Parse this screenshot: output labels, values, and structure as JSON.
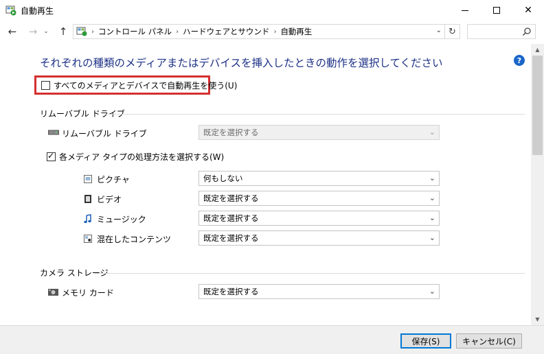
{
  "window": {
    "title": "自動再生",
    "icon": "autoplay-app-icon",
    "minimize_icon": "minimize-icon",
    "maximize_icon": "maximize-icon",
    "close_glyph": "✕"
  },
  "nav": {
    "back_glyph": "←",
    "forward_glyph": "→",
    "recent_glyph": "⌄",
    "up_glyph": "↑",
    "breadcrumb": [
      "コントロール パネル",
      "ハードウェアとサウンド",
      "自動再生"
    ],
    "breadcrumb_sep": "›",
    "dropdown_glyph": "⌄",
    "refresh_glyph": "↻",
    "search_placeholder": ""
  },
  "main": {
    "heading": "それぞれの種類のメディアまたはデバイスを挿入したときの動作を選択してください",
    "help_glyph": "?",
    "use_autoplay": {
      "label": "すべてのメディアとデバイスで自動再生を使う(U)",
      "checked": false
    },
    "removable": {
      "section_title": "リムーバブル ドライブ",
      "drive_label": "リムーバブル ドライブ",
      "drive_value": "既定を選択する",
      "per_media": {
        "label": "各メディア タイプの処理方法を選択する(W)",
        "checked": true
      },
      "media": [
        {
          "label": "ピクチャ",
          "value": "何もしない",
          "icon": "picture-icon",
          "enabled": true
        },
        {
          "label": "ビデオ",
          "value": "既定を選択する",
          "icon": "video-icon",
          "enabled": true
        },
        {
          "label": "ミュージック",
          "value": "既定を選択する",
          "icon": "music-icon",
          "enabled": true
        },
        {
          "label": "混在したコンテンツ",
          "value": "既定を選択する",
          "icon": "mixed-content-icon",
          "enabled": true
        }
      ]
    },
    "camera": {
      "section_title": "カメラ ストレージ",
      "memory_card_label": "メモリ カード",
      "memory_card_value": "既定を選択する"
    }
  },
  "footer": {
    "save_label": "保存(S)",
    "cancel_label": "キャンセル(C)"
  },
  "colors": {
    "heading": "#1e3287",
    "highlight": "#d32f2f",
    "primary_border": "#0078d7"
  }
}
